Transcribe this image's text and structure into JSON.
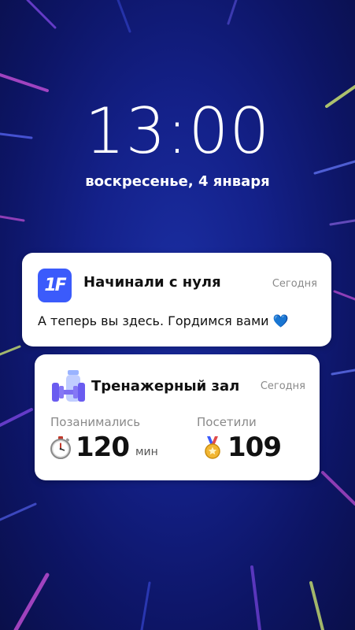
{
  "lockscreen": {
    "time": "13:00",
    "date": "воскресенье, 4 января"
  },
  "notifications": [
    {
      "app_icon_text": "1F",
      "title": "Начинали с нуля",
      "time": "Сегодня",
      "body": "А теперь вы здесь. Гордимся вами",
      "emoji": "💙"
    },
    {
      "icon": "gym-equipment-icon",
      "title": "Тренажерный зал",
      "time": "Сегодня",
      "stats": [
        {
          "label": "Позанимались",
          "icon": "stopwatch-icon",
          "value": "120",
          "unit": "мин"
        },
        {
          "label": "Посетили",
          "icon": "medal-icon",
          "value": "109"
        }
      ]
    }
  ],
  "colors": {
    "background": "#0d1566",
    "app_icon": "#3b5bfb",
    "accent_heart": "#3ea0f5",
    "gym_icon": "#6a5cf0"
  }
}
